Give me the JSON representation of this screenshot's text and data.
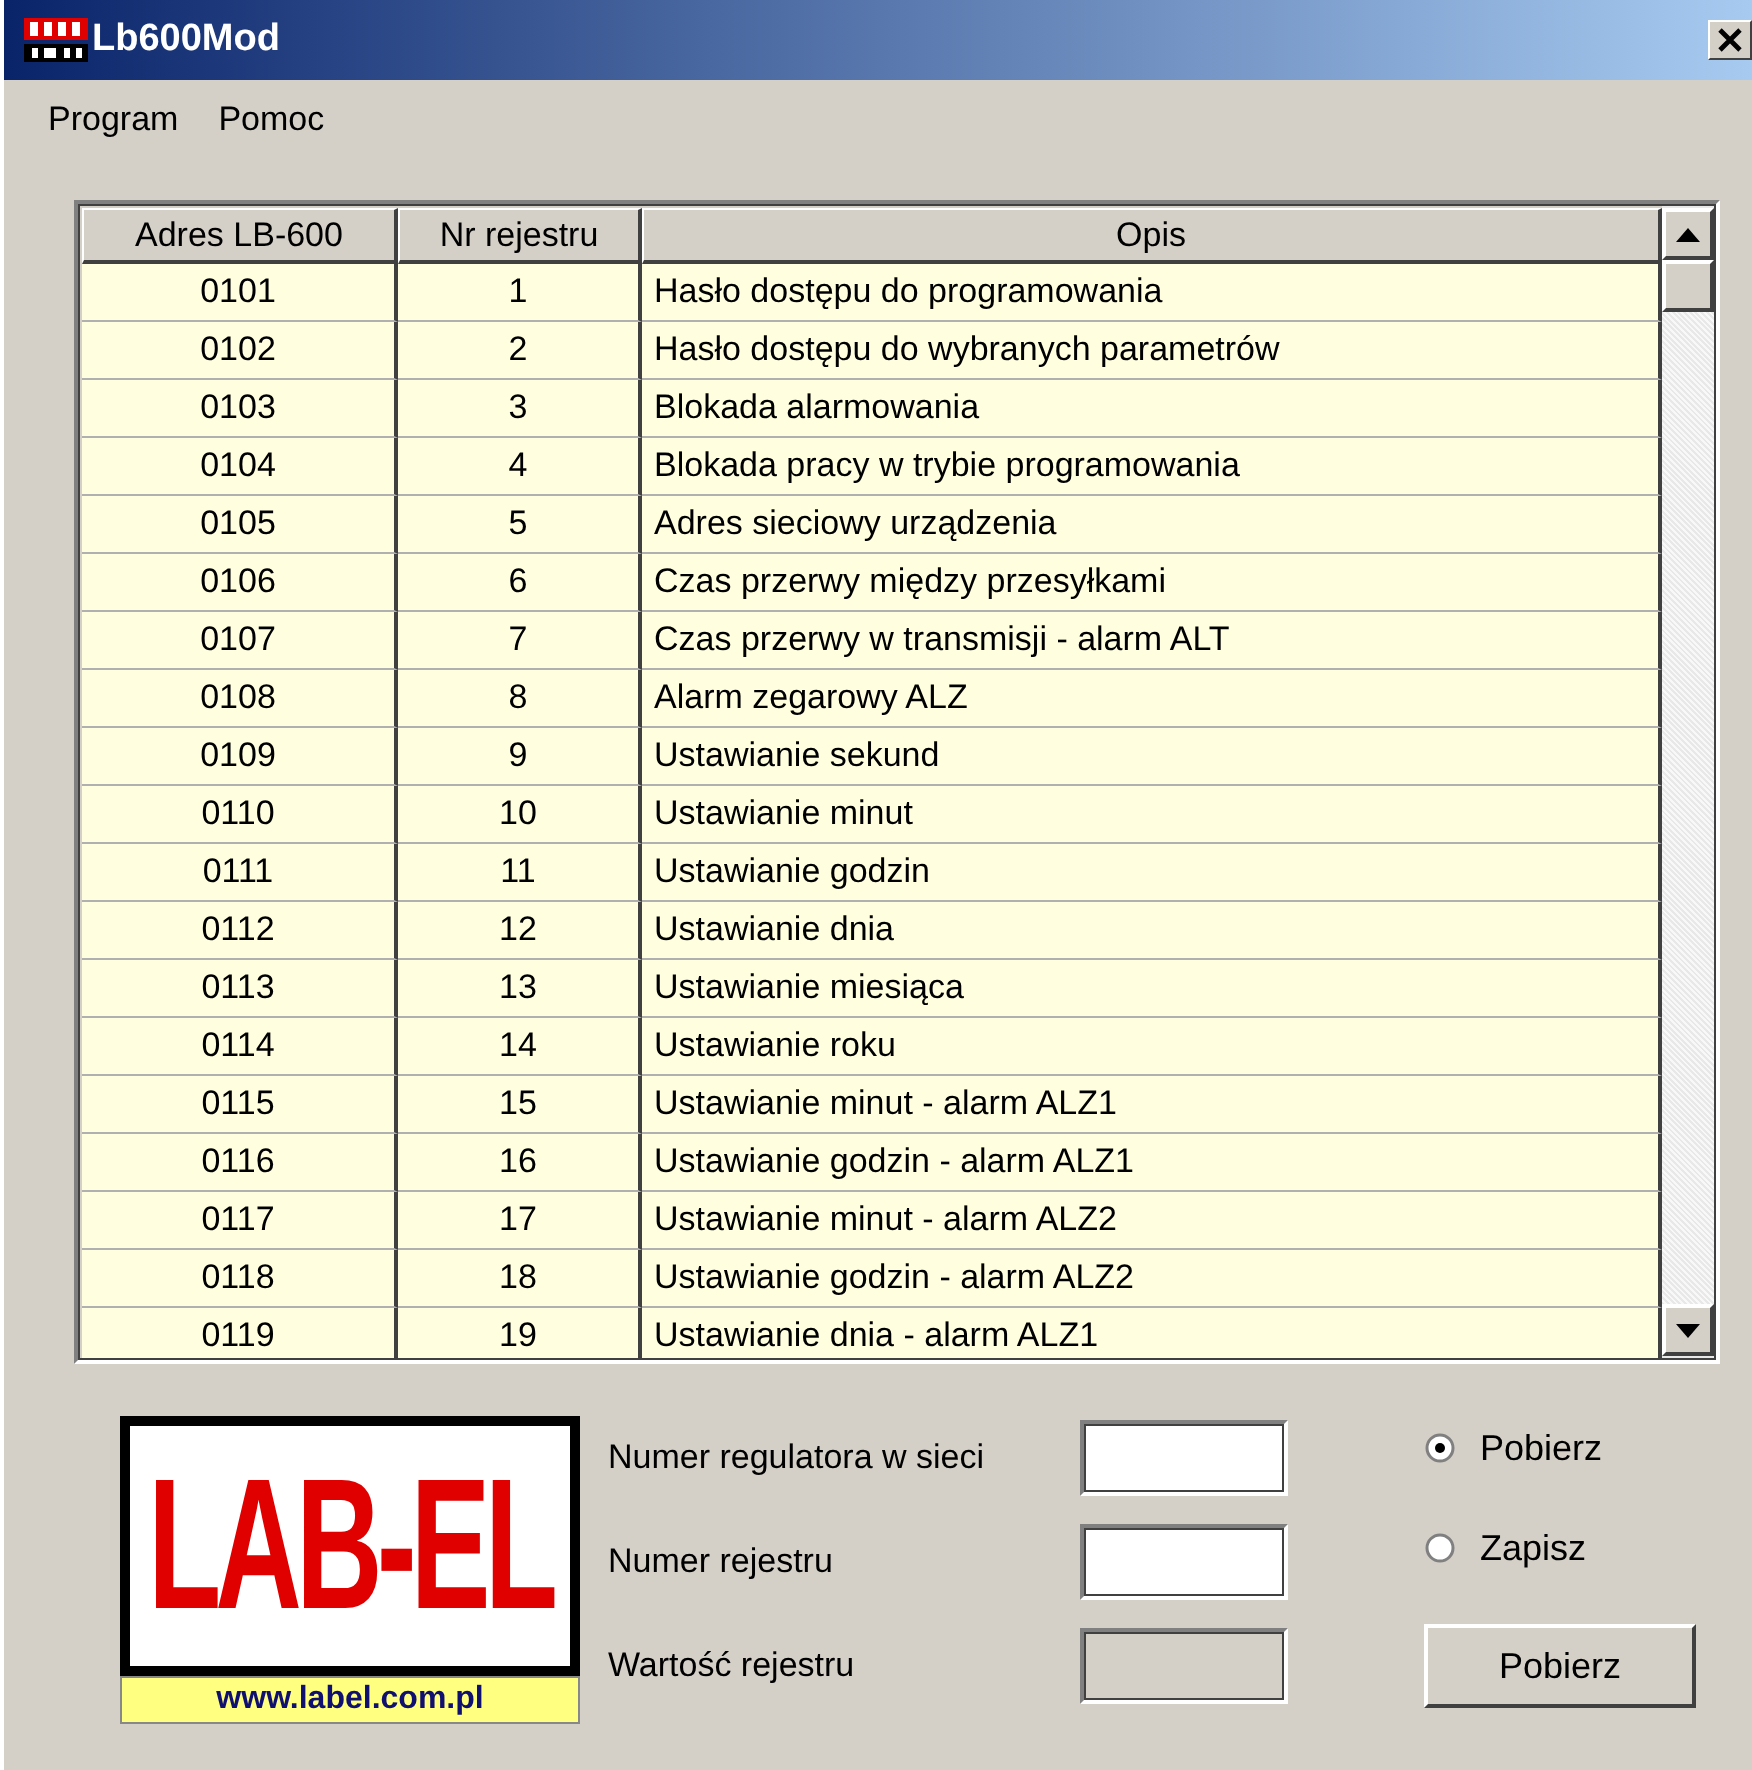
{
  "window": {
    "title": "Lb600Mod"
  },
  "menu": [
    "Program",
    "Pomoc"
  ],
  "table": {
    "columns": [
      "Adres LB-600",
      "Nr rejestru",
      "Opis"
    ],
    "rows": [
      [
        "0101",
        "1",
        "Hasło dostępu do programowania"
      ],
      [
        "0102",
        "2",
        "Hasło dostępu do wybranych parametrów"
      ],
      [
        "0103",
        "3",
        "Blokada alarmowania"
      ],
      [
        "0104",
        "4",
        "Blokada pracy w trybie programowania"
      ],
      [
        "0105",
        "5",
        "Adres sieciowy urządzenia"
      ],
      [
        "0106",
        "6",
        "Czas przerwy między przesyłkami"
      ],
      [
        "0107",
        "7",
        "Czas przerwy w transmisji - alarm ALT"
      ],
      [
        "0108",
        "8",
        "Alarm zegarowy ALZ"
      ],
      [
        "0109",
        "9",
        "Ustawianie sekund"
      ],
      [
        "0110",
        "10",
        "Ustawianie minut"
      ],
      [
        "0111",
        "11",
        "Ustawianie godzin"
      ],
      [
        "0112",
        "12",
        "Ustawianie dnia"
      ],
      [
        "0113",
        "13",
        "Ustawianie miesiąca"
      ],
      [
        "0114",
        "14",
        "Ustawianie roku"
      ],
      [
        "0115",
        "15",
        "Ustawianie minut - alarm ALZ1"
      ],
      [
        "0116",
        "16",
        "Ustawianie godzin - alarm ALZ1"
      ],
      [
        "0117",
        "17",
        "Ustawianie minut - alarm ALZ2"
      ],
      [
        "0118",
        "18",
        "Ustawianie godzin - alarm ALZ2"
      ],
      [
        "0119",
        "19",
        "Ustawianie dnia - alarm ALZ1"
      ]
    ]
  },
  "logo": {
    "text": "LAB-EL",
    "url": "www.label.com.pl"
  },
  "fields": [
    {
      "label": "Numer regulatora w sieci",
      "disabled": false
    },
    {
      "label": "Numer rejestru",
      "disabled": false
    },
    {
      "label": "Wartość rejestru",
      "disabled": true
    }
  ],
  "radios": [
    {
      "label": "Pobierz",
      "selected": true
    },
    {
      "label": "Zapisz",
      "selected": false
    }
  ],
  "button": "Pobierz"
}
